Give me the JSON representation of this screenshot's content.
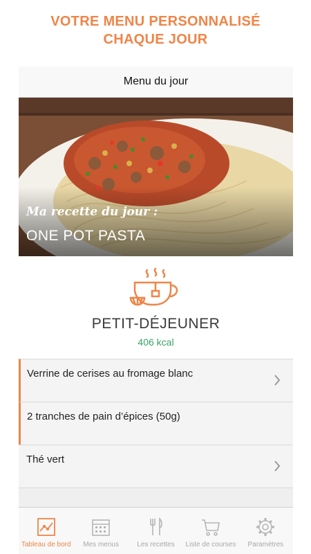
{
  "promo": {
    "line1": "VOTRE MENU PERSONNALISÉ",
    "line2": "CHAQUE JOUR"
  },
  "navbar": {
    "title": "Menu du jour"
  },
  "hero": {
    "kicker": "Ma recette du jour :",
    "title": "ONE POT PASTA"
  },
  "meal": {
    "name": "PETIT-DÉJEUNER",
    "kcal": "406 kcal",
    "icon": "tea-cup-icon"
  },
  "items": [
    {
      "label": "Verrine de cerises au fromage blanc",
      "chevron": true,
      "accent": true
    },
    {
      "label": "2 tranches de pain d’épices (50g)",
      "chevron": false,
      "accent": true
    },
    {
      "label": "Thé vert",
      "chevron": true,
      "accent": false
    }
  ],
  "tabs": [
    {
      "label": "Tableau de bord",
      "icon": "dashboard-chart-icon",
      "active": true
    },
    {
      "label": "Mes menus",
      "icon": "calendar-icon",
      "active": false
    },
    {
      "label": "Les recettes",
      "icon": "fork-knife-icon",
      "active": false
    },
    {
      "label": "Liste de courses",
      "icon": "shopping-cart-icon",
      "active": false
    },
    {
      "label": "Paramètres",
      "icon": "gear-icon",
      "active": false
    }
  ],
  "colors": {
    "accent": "#ee8548",
    "kcal": "#3aa36a",
    "inactive_tab": "#a8a8a8"
  }
}
